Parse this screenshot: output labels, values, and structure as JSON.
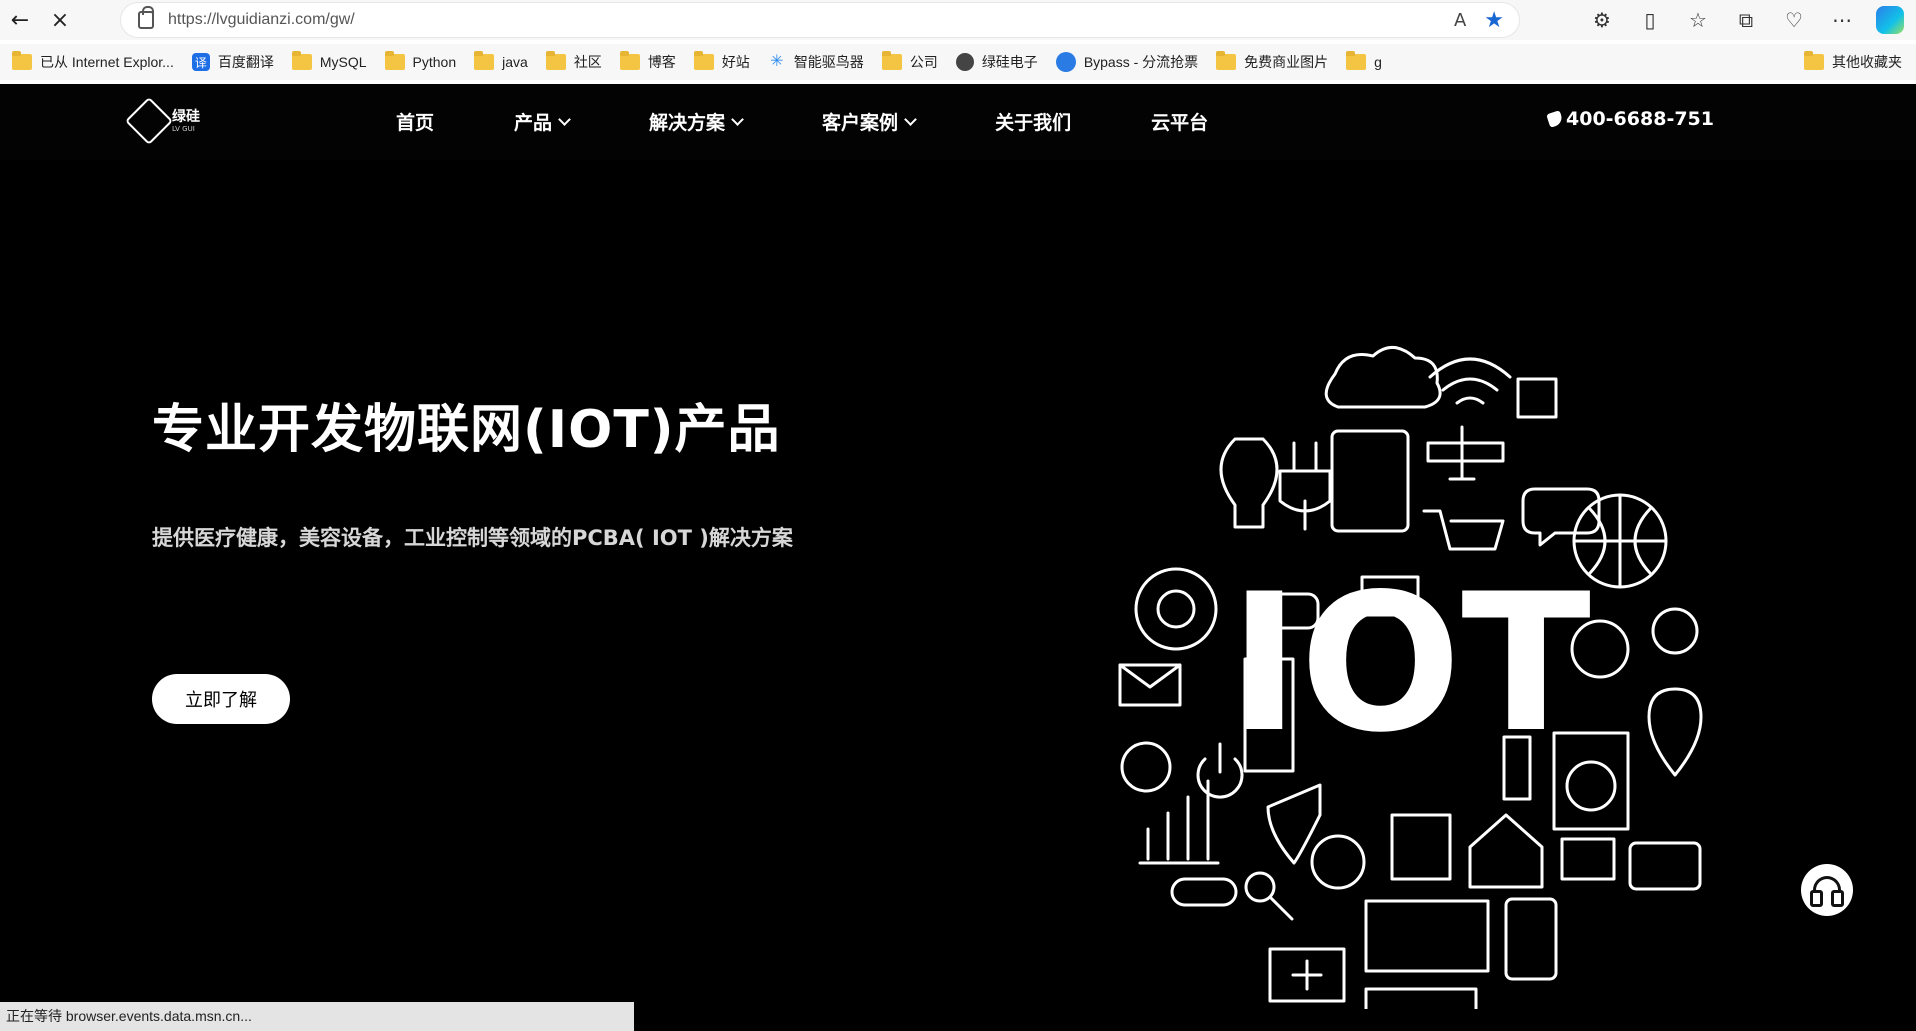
{
  "browser": {
    "url": "https://lvguidianzi.com/gw/",
    "read_aloud_label": "A",
    "buttons": {
      "back_icon": "back-arrow-icon",
      "stop_icon": "close-icon"
    }
  },
  "bookmarks": [
    {
      "label": "已从 Internet Explor...",
      "icon": "folder-icon"
    },
    {
      "label": "百度翻译",
      "icon": "translate-icon"
    },
    {
      "label": "MySQL",
      "icon": "folder-icon"
    },
    {
      "label": "Python",
      "icon": "folder-icon"
    },
    {
      "label": "java",
      "icon": "folder-icon"
    },
    {
      "label": "社区",
      "icon": "folder-icon"
    },
    {
      "label": "博客",
      "icon": "folder-icon"
    },
    {
      "label": "好站",
      "icon": "folder-icon"
    },
    {
      "label": "智能驱鸟器",
      "icon": "sparkle-icon"
    },
    {
      "label": "公司",
      "icon": "folder-icon"
    },
    {
      "label": "绿硅电子",
      "icon": "site-icon"
    },
    {
      "label": "Bypass - 分流抢票",
      "icon": "bypass-icon"
    },
    {
      "label": "免费商业图片",
      "icon": "folder-icon"
    },
    {
      "label": "g",
      "icon": "folder-icon"
    }
  ],
  "other_bookmarks": {
    "label": "其他收藏夹"
  },
  "site": {
    "logo_text": "绿硅",
    "logo_subtext": "LV GUI",
    "menu": [
      {
        "label": "首页",
        "has_dropdown": false
      },
      {
        "label": "产品",
        "has_dropdown": true
      },
      {
        "label": "解决方案",
        "has_dropdown": true
      },
      {
        "label": "客户案例",
        "has_dropdown": true
      },
      {
        "label": "关于我们",
        "has_dropdown": false
      },
      {
        "label": "云平台",
        "has_dropdown": false
      }
    ],
    "phone": "400-6688-751"
  },
  "hero": {
    "title": "专业开发物联网(IOT)产品",
    "subtitle": "提供医疗健康，美容设备，工业控制等领域的PCBA( IOT )解决方案",
    "button": "立即了解",
    "iot_text": "IOT"
  },
  "status": {
    "text": "正在等待 browser.events.data.msn.cn..."
  }
}
